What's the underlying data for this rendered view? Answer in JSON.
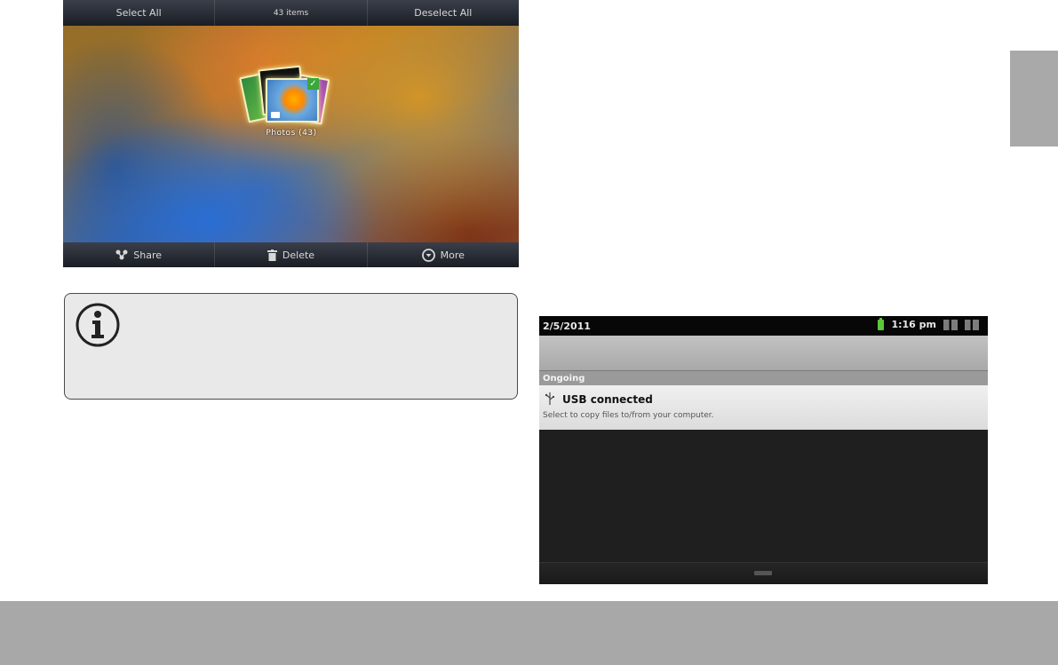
{
  "gallery": {
    "top_bar": {
      "select_all": "Select All",
      "count": "43 items",
      "deselect_all": "Deselect All"
    },
    "album": {
      "label": "Photos  (43)"
    },
    "bottom_bar": {
      "share": "Share",
      "delete": "Delete",
      "more": "More"
    }
  },
  "notification_panel": {
    "status_bar": {
      "date": "2/5/2011",
      "time": "1:16 pm"
    },
    "section_header": "Ongoing",
    "item": {
      "title": "USB connected",
      "subtitle": "Select to copy files to/from your computer."
    }
  },
  "colors": {
    "footer": "#a8a8a8",
    "side_tab": "#a9a9a9",
    "note_background": "#e9e9e9"
  }
}
